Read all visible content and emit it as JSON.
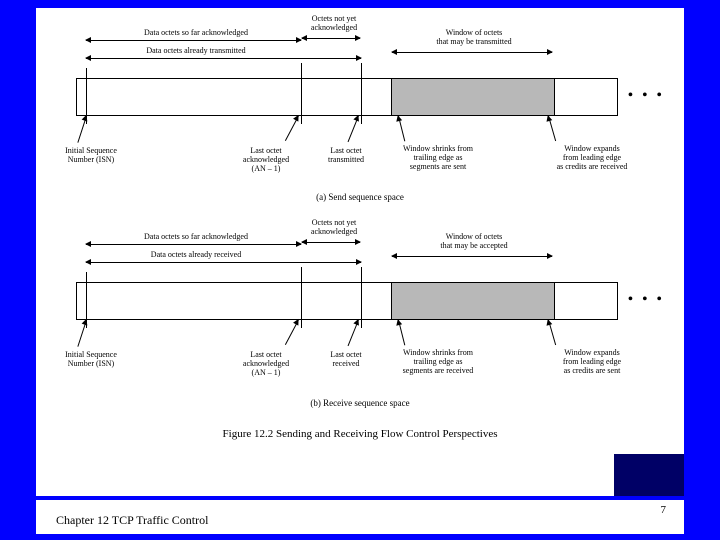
{
  "footer": {
    "chapter": "Chapter 12 TCP Traffic Control",
    "page": "7"
  },
  "figure": {
    "title": "Figure 12.2   Sending and Receiving Flow Control Perspectives"
  },
  "send": {
    "caption": "(a) Send sequence space",
    "top": {
      "ack": "Data octets so far acknowledged",
      "xmit": "Data octets already transmitted",
      "notyet": "Octets not yet\nacknowledged",
      "window": "Window of octets\nthat may be transmitted"
    },
    "bottom": {
      "isn": "Initial Sequence\nNumber (ISN)",
      "lastack": "Last octet\nacknowledged\n(AN – 1)",
      "lastxmit": "Last octet\ntransmitted",
      "shrink": "Window shrinks from\ntrailing edge as\nsegments are sent",
      "expand": "Window expands\nfrom leading edge\nas credits are received"
    }
  },
  "recv": {
    "caption": "(b) Receive sequence space",
    "top": {
      "ack": "Data octets so far acknowledged",
      "rcvd": "Data octets already received",
      "notyet": "Octets not yet\nacknowledged",
      "window": "Window of octets\nthat may be accepted"
    },
    "bottom": {
      "isn": "Initial Sequence\nNumber (ISN)",
      "lastack": "Last octet\nacknowledged\n(AN – 1)",
      "lastrcv": "Last octet\nreceived",
      "shrink": "Window shrinks from\ntrailing edge as\nsegments are received",
      "expand": "Window expands\nfrom leading edge\nas credits are sent"
    }
  },
  "dots": "• • •"
}
